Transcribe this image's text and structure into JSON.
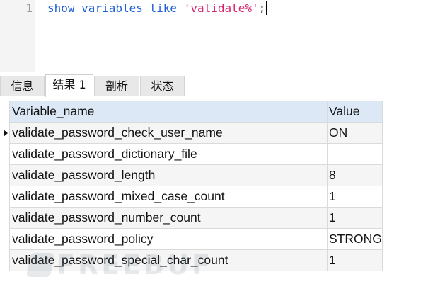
{
  "editor": {
    "line_number": "1",
    "code_keyword1": "show",
    "code_keyword2": "variables",
    "code_keyword3": "like",
    "code_string": "'validate%'",
    "code_terminator": ";"
  },
  "tabs": [
    {
      "label": "信息"
    },
    {
      "label": "结果 1"
    },
    {
      "label": "剖析"
    },
    {
      "label": "状态"
    }
  ],
  "active_tab": "结果 1",
  "grid": {
    "columns": [
      "Variable_name",
      "Value"
    ],
    "rows": [
      {
        "name": "validate_password_check_user_name",
        "value": "ON"
      },
      {
        "name": "validate_password_dictionary_file",
        "value": ""
      },
      {
        "name": "validate_password_length",
        "value": "8"
      },
      {
        "name": "validate_password_mixed_case_count",
        "value": "1"
      },
      {
        "name": "validate_password_number_count",
        "value": "1"
      },
      {
        "name": "validate_password_policy",
        "value": "STRONG"
      },
      {
        "name": "validate_password_special_char_count",
        "value": "1"
      }
    ],
    "selected_row_index": 0
  },
  "watermark_text": "FREEBUF",
  "colors": {
    "keyword": "#1f5fd6",
    "string": "#d6236b",
    "header_bg": "#dde8f6",
    "alt_row_bg": "#f5f5f5"
  }
}
